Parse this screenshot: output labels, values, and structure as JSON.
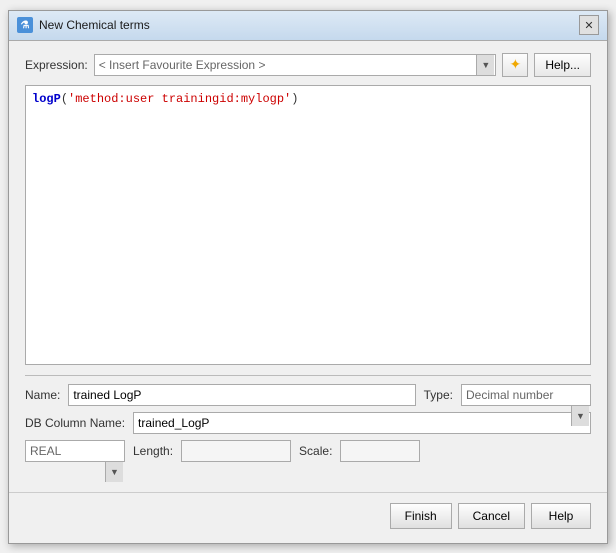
{
  "window": {
    "title": "New Chemical terms",
    "close_label": "✕"
  },
  "toolbar": {
    "expression_label": "Expression:",
    "expression_placeholder": "< Insert Favourite Expression >",
    "star_icon": "✦",
    "help_btn": "Help..."
  },
  "editor": {
    "code": {
      "function_name": "logP",
      "param": "'method:user trainingid:mylogp'"
    }
  },
  "form": {
    "name_label": "Name:",
    "name_value": "trained LogP",
    "type_label": "Type:",
    "type_value": "Decimal number",
    "db_column_label": "DB Column Name:",
    "db_column_value": "trained_LogP",
    "data_type_value": "REAL",
    "length_label": "Length:",
    "length_value": "",
    "scale_label": "Scale:",
    "scale_value": ""
  },
  "footer": {
    "finish_label": "Finish",
    "cancel_label": "Cancel",
    "help_label": "Help"
  }
}
